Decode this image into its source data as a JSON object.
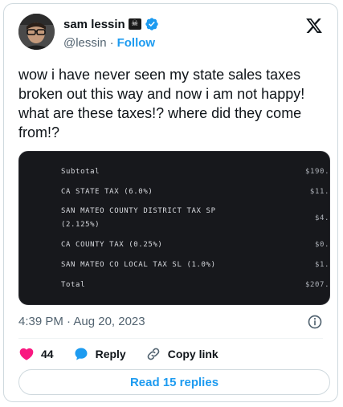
{
  "author": {
    "display_name": "sam lessin",
    "handle": "@lessin",
    "separator": "·",
    "follow_label": "Follow",
    "badge_glyph": "☠"
  },
  "tweet": {
    "text": "wow i have never seen my state sales taxes broken out this way and now i am not happy! what are these taxes!? where did they come from!?",
    "timestamp": "4:39 PM · Aug 20, 2023"
  },
  "receipt": {
    "rows": [
      {
        "label": "Subtotal",
        "amount": "$190.",
        "style": "plain"
      },
      {
        "label": "CA STATE TAX (6.0%)",
        "amount": "$11.",
        "style": "caps"
      },
      {
        "label": "SAN MATEO COUNTY DISTRICT TAX SP",
        "label2": "(2.125%)",
        "amount": "$4.",
        "style": "caps"
      },
      {
        "label": "CA COUNTY TAX (0.25%)",
        "amount": "$0.",
        "style": "caps"
      },
      {
        "label": "SAN MATEO CO LOCAL TAX SL (1.0%)",
        "amount": "$1.",
        "style": "caps"
      },
      {
        "label": "Total",
        "amount": "$207.",
        "style": "plain"
      }
    ]
  },
  "actions": {
    "like_count": "44",
    "reply_label": "Reply",
    "copy_link_label": "Copy link"
  },
  "read_replies_label": "Read 15 replies",
  "colors": {
    "accent": "#1d9bf0",
    "like": "#f91880",
    "receipt_bg": "#17181c"
  },
  "icons": [
    "verified-badge-icon",
    "x-logo-icon",
    "info-icon",
    "heart-icon",
    "reply-bubble-icon",
    "link-icon",
    "skull-icon"
  ]
}
